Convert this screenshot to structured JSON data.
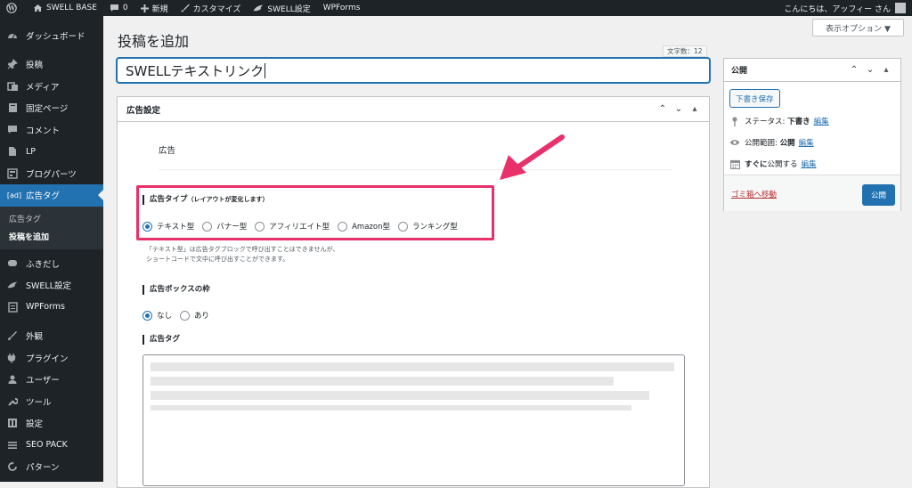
{
  "adminbar": {
    "site_name": "SWELL BASE",
    "comments_count": "0",
    "new_label": "新規",
    "customize_label": "カスタマイズ",
    "swell_settings_label": "SWELL設定",
    "wpforms_label": "WPForms",
    "greeting": "こんにちは、アッフィー さん"
  },
  "sidebar": {
    "items": [
      {
        "label": "ダッシュボード",
        "icon": "dashboard-icon"
      },
      {
        "label": "投稿",
        "icon": "pin-icon"
      },
      {
        "label": "メディア",
        "icon": "media-icon"
      },
      {
        "label": "固定ページ",
        "icon": "page-icon"
      },
      {
        "label": "コメント",
        "icon": "comment-icon"
      },
      {
        "label": "LP",
        "icon": "lp-icon"
      },
      {
        "label": "ブログパーツ",
        "icon": "blogparts-icon"
      },
      {
        "label": "広告タグ",
        "icon": "ad-icon"
      },
      {
        "label": "ふきだし",
        "icon": "balloon-icon"
      },
      {
        "label": "SWELL設定",
        "icon": "swell-icon"
      },
      {
        "label": "WPForms",
        "icon": "wpforms-icon"
      },
      {
        "label": "外観",
        "icon": "appearance-icon"
      },
      {
        "label": "プラグイン",
        "icon": "plugin-icon"
      },
      {
        "label": "ユーザー",
        "icon": "user-icon"
      },
      {
        "label": "ツール",
        "icon": "tool-icon"
      },
      {
        "label": "設定",
        "icon": "settings-icon"
      },
      {
        "label": "SEO PACK",
        "icon": "seo-icon"
      },
      {
        "label": "パターン",
        "icon": "pattern-icon"
      }
    ],
    "ad_icon_text": "[ad]",
    "submenu": [
      "広告タグ",
      "投稿を追加"
    ]
  },
  "page": {
    "title": "投稿を追加",
    "screen_options": "表示オプション ▼",
    "word_count": "文字数：12",
    "post_title": "SWELLテキストリンク"
  },
  "adbox": {
    "title": "広告設定",
    "section_label": "広告",
    "type_title": "広告タイプ",
    "type_note": "（レイアウトが変化します）",
    "types": [
      "テキスト型",
      "バナー型",
      "アフィリエイト型",
      "Amazon型",
      "ランキング型"
    ],
    "selected_type": "テキスト型",
    "note_line1": "「テキスト型」は広告タグブロックで呼び出すことはできませんが、",
    "note_line2": "ショートコードで文中に呼び出すことができます。",
    "border_title": "広告ボックスの枠",
    "border_options": [
      "なし",
      "あり"
    ],
    "selected_border": "なし",
    "tag_title": "広告タグ"
  },
  "publish": {
    "title": "公開",
    "save_draft": "下書き保存",
    "status_label": "ステータス:",
    "status_value": "下書き",
    "visibility_label": "公開範囲:",
    "visibility_value": "公開",
    "schedule_prefix": "すぐに",
    "schedule_label": "公開する",
    "edit_label": "編集",
    "trash_label": "ゴミ箱へ移動",
    "publish_button": "公開"
  },
  "colors": {
    "accent": "#2271b1",
    "highlight": "#e8316a",
    "sidebar_bg": "#1d2327"
  }
}
